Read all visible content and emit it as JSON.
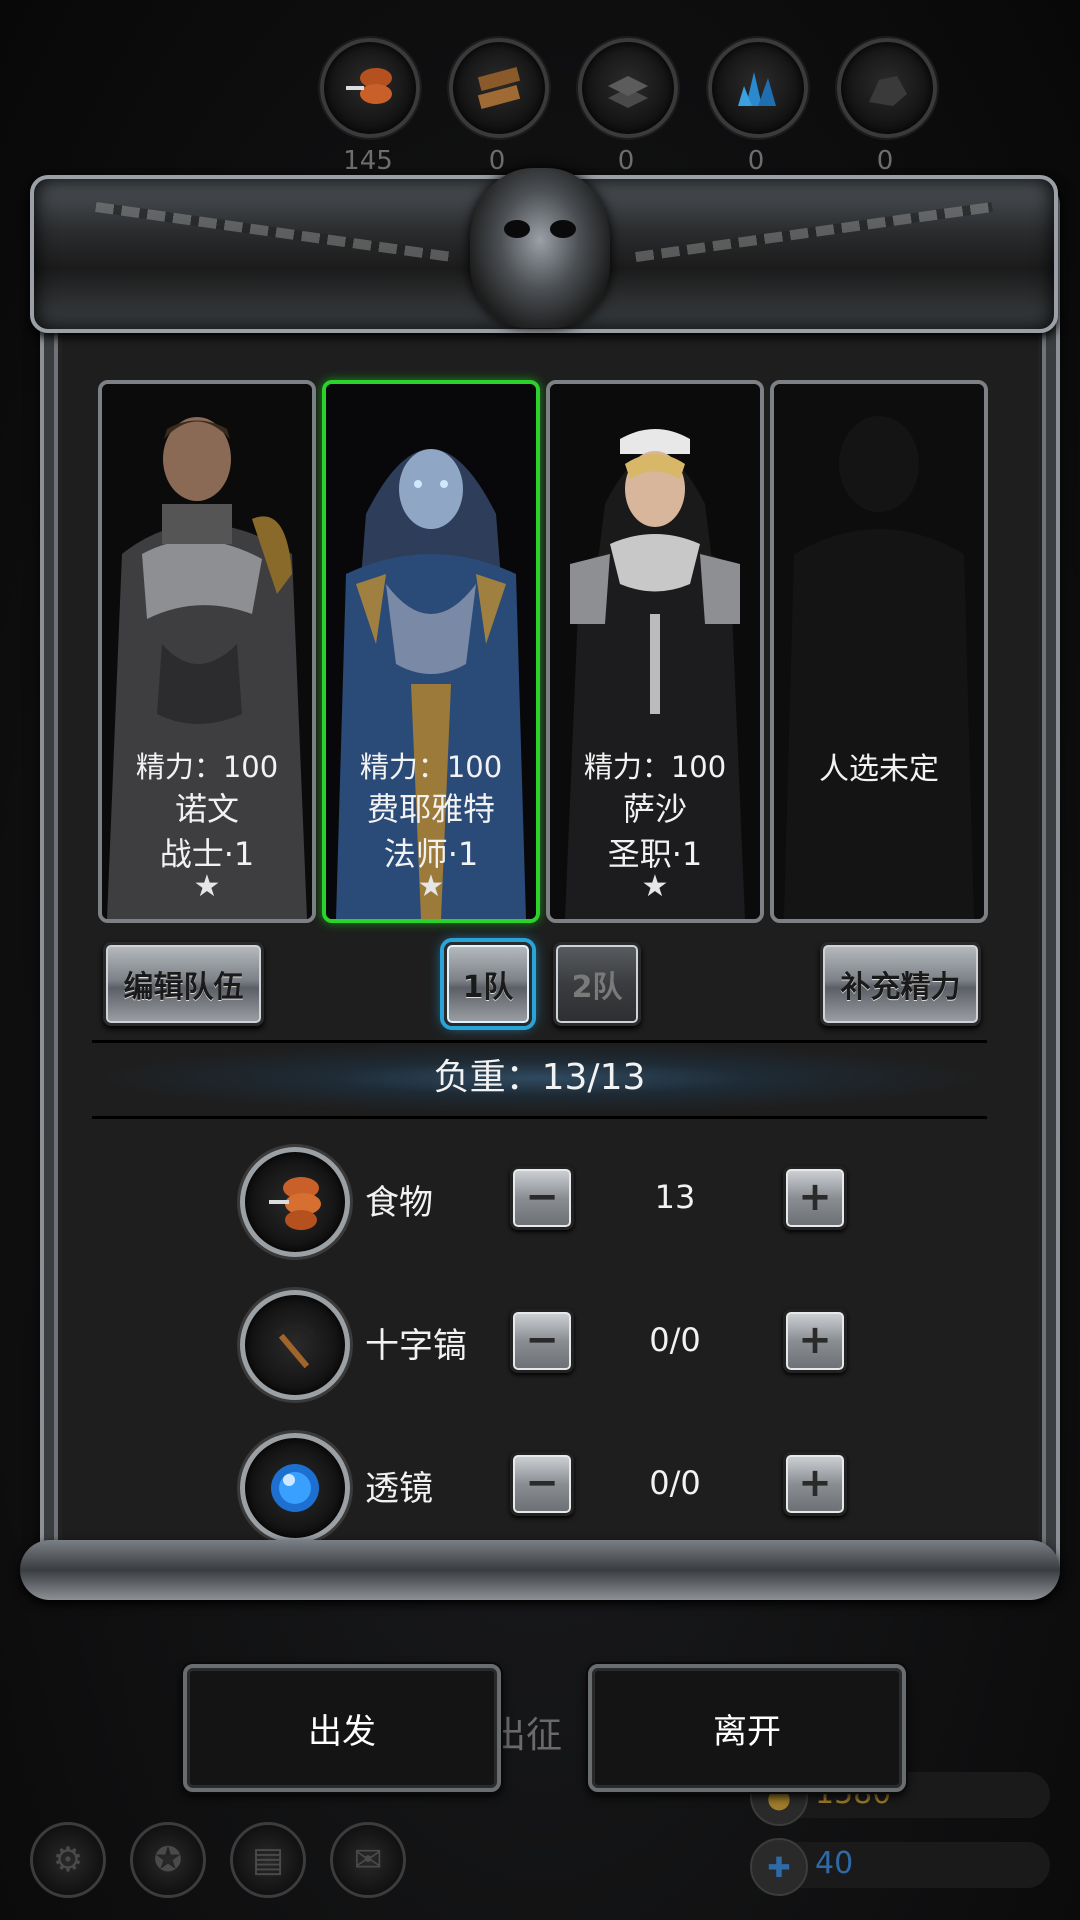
{
  "resources": [
    {
      "icon": "meat-icon",
      "value": "145"
    },
    {
      "icon": "wood-icon",
      "value": "0"
    },
    {
      "icon": "iron-icon",
      "value": "0"
    },
    {
      "icon": "crystal-icon",
      "value": "0"
    },
    {
      "icon": "ore-icon",
      "value": "0"
    }
  ],
  "heroes": [
    {
      "stamina": "精力：100",
      "name": "诺文",
      "class": "战士·1",
      "star": "★"
    },
    {
      "stamina": "精力：100",
      "name": "费耶雅特",
      "class": "法师·1",
      "star": "★"
    },
    {
      "stamina": "精力：100",
      "name": "萨沙",
      "class": "圣职·1",
      "star": "★"
    },
    {
      "pending": "人选未定"
    }
  ],
  "buttons": {
    "edit_team": "编辑队伍",
    "team1": "1队",
    "team2": "2队",
    "restore": "补充精力"
  },
  "weight": "负重：13/13",
  "supplies": [
    {
      "icon": "food-icon",
      "label": "食物",
      "value": "13"
    },
    {
      "icon": "pickaxe-icon",
      "label": "十字镐",
      "value": "0/0"
    },
    {
      "icon": "lens-icon",
      "label": "透镜",
      "value": "0/0"
    }
  ],
  "stepper": {
    "minus": "−",
    "plus": "+"
  },
  "actions": {
    "depart": "出发",
    "leave": "离开"
  },
  "background": {
    "expedition": "出征",
    "gold": "1580",
    "gems": "40"
  },
  "colors": {
    "selected_border": "#2bd22b",
    "active_team_glow": "#2aa4d8",
    "gold_text": "#a07d2a",
    "gem_text": "#2f6aa8"
  }
}
